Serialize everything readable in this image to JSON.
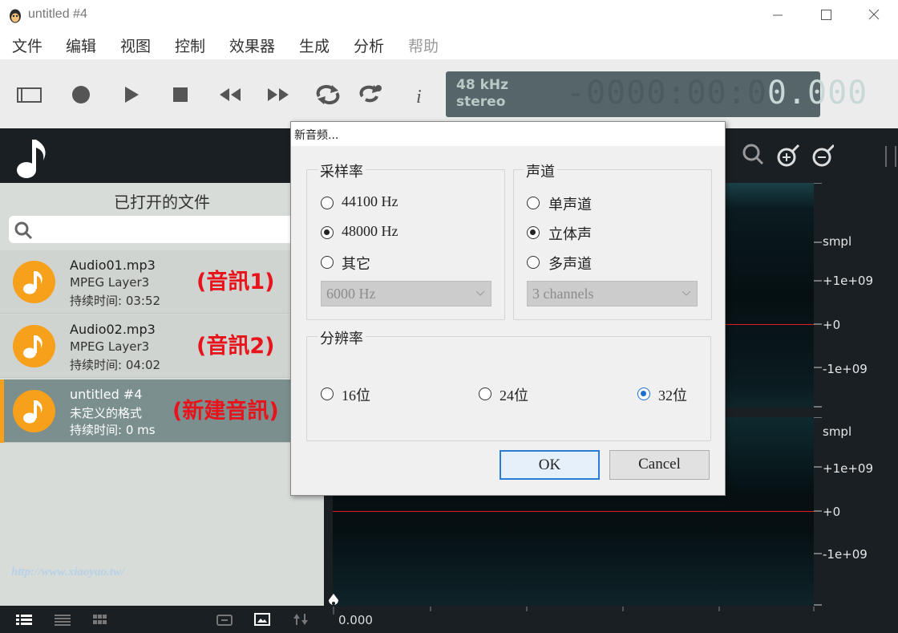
{
  "window": {
    "title": "untitled #4",
    "icon": "tenacity-icon"
  },
  "menu": [
    "文件",
    "编辑",
    "视图",
    "控制",
    "效果器",
    "生成",
    "分析",
    "帮助"
  ],
  "toolbar": {
    "buttons": [
      "toggle-view-icon",
      "record-icon",
      "play-icon",
      "stop-icon",
      "rewind-icon",
      "fast-forward-icon",
      "loop-icon",
      "loop-add-icon",
      "info-icon"
    ],
    "lcd": {
      "rate": "48 kHz",
      "channels": "stereo",
      "time_dim": "-0000:00:0",
      "time_bright": "0.000"
    }
  },
  "sidebar": {
    "heading": "已打开的文件",
    "search_placeholder": "",
    "files": [
      {
        "name": "Audio01.mp3",
        "format": "MPEG Layer3",
        "duration": "持续时间: 03:52",
        "note": "(音訊1)"
      },
      {
        "name": "Audio02.mp3",
        "format": "MPEG Layer3",
        "duration": "持续时间: 04:02",
        "note": "(音訊2)"
      },
      {
        "name": "untitled #4",
        "format": "未定义的格式",
        "duration": "持续时间: 0 ms",
        "note": "(新建音訊)"
      }
    ],
    "selected_index": 2
  },
  "waveform": {
    "axis1": [
      "smpl",
      "+1e+09",
      "+0",
      "-1e+09"
    ],
    "axis2": [
      "smpl",
      "+1e+09",
      "+0",
      "-1e+09"
    ],
    "timeline_start": "0.000"
  },
  "dialog": {
    "title": "新音频...",
    "sample_rate": {
      "label": "采样率",
      "options": [
        "44100 Hz",
        "48000 Hz",
        "其它"
      ],
      "selected": "48000 Hz",
      "other_value": "6000 Hz"
    },
    "channels": {
      "label": "声道",
      "options": [
        "单声道",
        "立体声",
        "多声道"
      ],
      "selected": "立体声",
      "multi_value": "3 channels"
    },
    "resolution": {
      "label": "分辨率",
      "options": [
        "16位",
        "24位",
        "32位"
      ],
      "selected": "32位"
    },
    "ok_label": "OK",
    "cancel_label": "Cancel"
  },
  "watermark": "http://www.xiaoyao.tw/",
  "colors": {
    "accent": "#f7a01b",
    "note_red": "#e8141c",
    "selection_blue": "#1a6fd0"
  }
}
